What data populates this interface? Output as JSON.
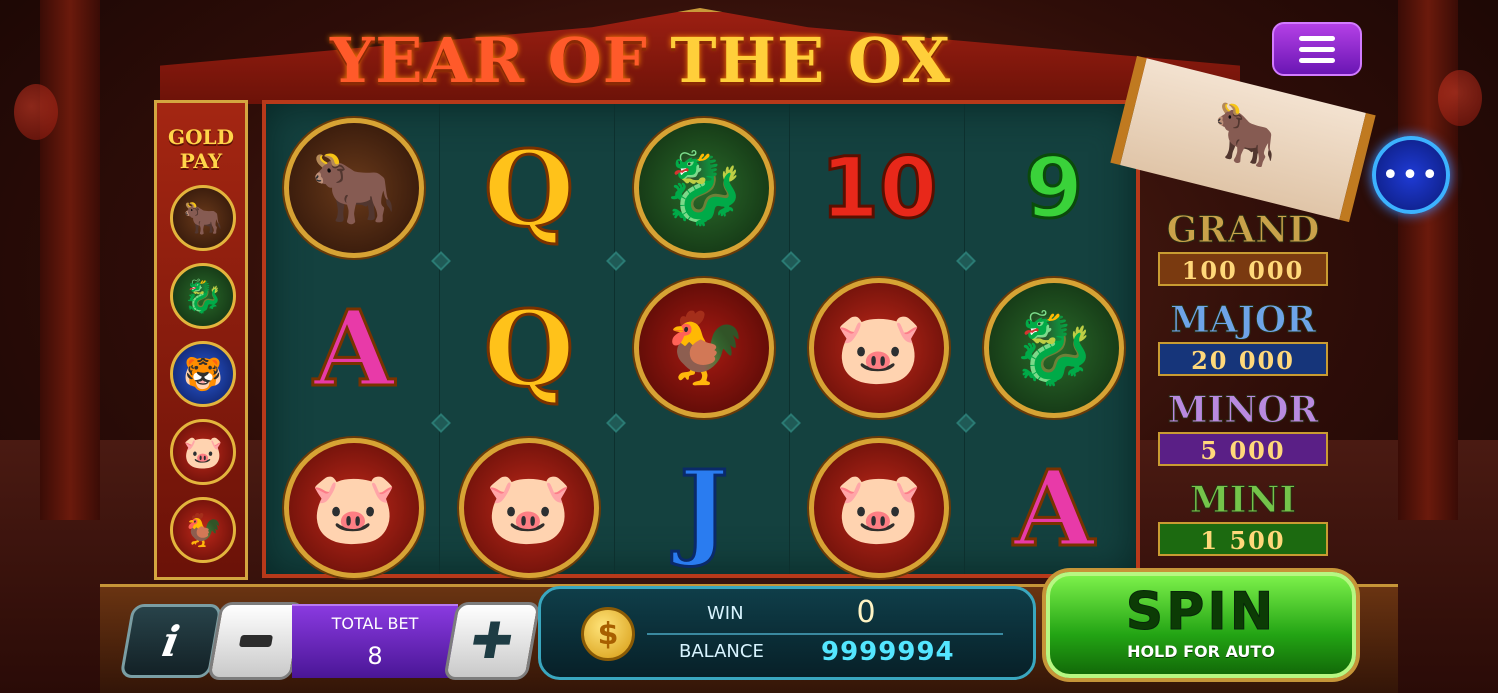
{
  "title": {
    "part1": "YEAR OF ",
    "part2": "THE OX"
  },
  "paytable": {
    "title_line1": "GOLD",
    "title_line2": "PAY",
    "icons": [
      "ox-icon",
      "dragon-icon",
      "blue-tiger-icon",
      "pig-icon",
      "rooster-icon"
    ]
  },
  "reels": {
    "columns": [
      [
        {
          "type": "icon",
          "name": "ox-icon",
          "glyph": "🐂"
        },
        {
          "type": "letter",
          "name": "A",
          "text": "A"
        },
        {
          "type": "icon",
          "name": "pig-icon",
          "glyph": "🐷"
        }
      ],
      [
        {
          "type": "letter",
          "name": "Q",
          "text": "Q"
        },
        {
          "type": "letter",
          "name": "Q",
          "text": "Q"
        },
        {
          "type": "icon",
          "name": "pig-icon",
          "glyph": "🐷"
        }
      ],
      [
        {
          "type": "icon",
          "name": "dragon-icon",
          "glyph": "🐉"
        },
        {
          "type": "icon",
          "name": "rooster-icon",
          "glyph": "🐓"
        },
        {
          "type": "letter",
          "name": "J",
          "text": "J"
        }
      ],
      [
        {
          "type": "num",
          "name": "10",
          "text": "10"
        },
        {
          "type": "icon",
          "name": "pig-icon",
          "glyph": "🐷"
        },
        {
          "type": "icon",
          "name": "pig-icon",
          "glyph": "🐷"
        }
      ],
      [
        {
          "type": "num",
          "name": "9",
          "text": "9"
        },
        {
          "type": "icon",
          "name": "dragon-icon",
          "glyph": "🐉"
        },
        {
          "type": "letter",
          "name": "A",
          "text": "A"
        }
      ]
    ]
  },
  "jackpots": [
    {
      "label": "GRAND",
      "value": "100 000",
      "color": "#c9a24a",
      "bg": "#7a3a10"
    },
    {
      "label": "MAJOR",
      "value": "20 000",
      "color": "#6ea4e8",
      "bg": "#16357a"
    },
    {
      "label": "MINOR",
      "value": "5 000",
      "color": "#b98ae0",
      "bg": "#5a1f86"
    },
    {
      "label": "MINI",
      "value": "1 500",
      "color": "#74c44a",
      "bg": "#1c6a10"
    }
  ],
  "controls": {
    "info_label": "i",
    "minus_icon": "minus-icon",
    "plus_icon": "plus-icon",
    "total_bet_label": "TOTAL BET",
    "total_bet_value": "8",
    "win_label": "WIN",
    "win_value": "0",
    "balance_label": "BALANCE",
    "balance_value": "9999994",
    "coin_symbol": "$",
    "spin_label": "SPIN",
    "spin_sub": "HOLD FOR AUTO"
  },
  "colors": {
    "accent_gold": "#d4a640",
    "reel_bg": "#14413f",
    "spin_green": "#23a414",
    "balance_cyan": "#54e6ff"
  }
}
